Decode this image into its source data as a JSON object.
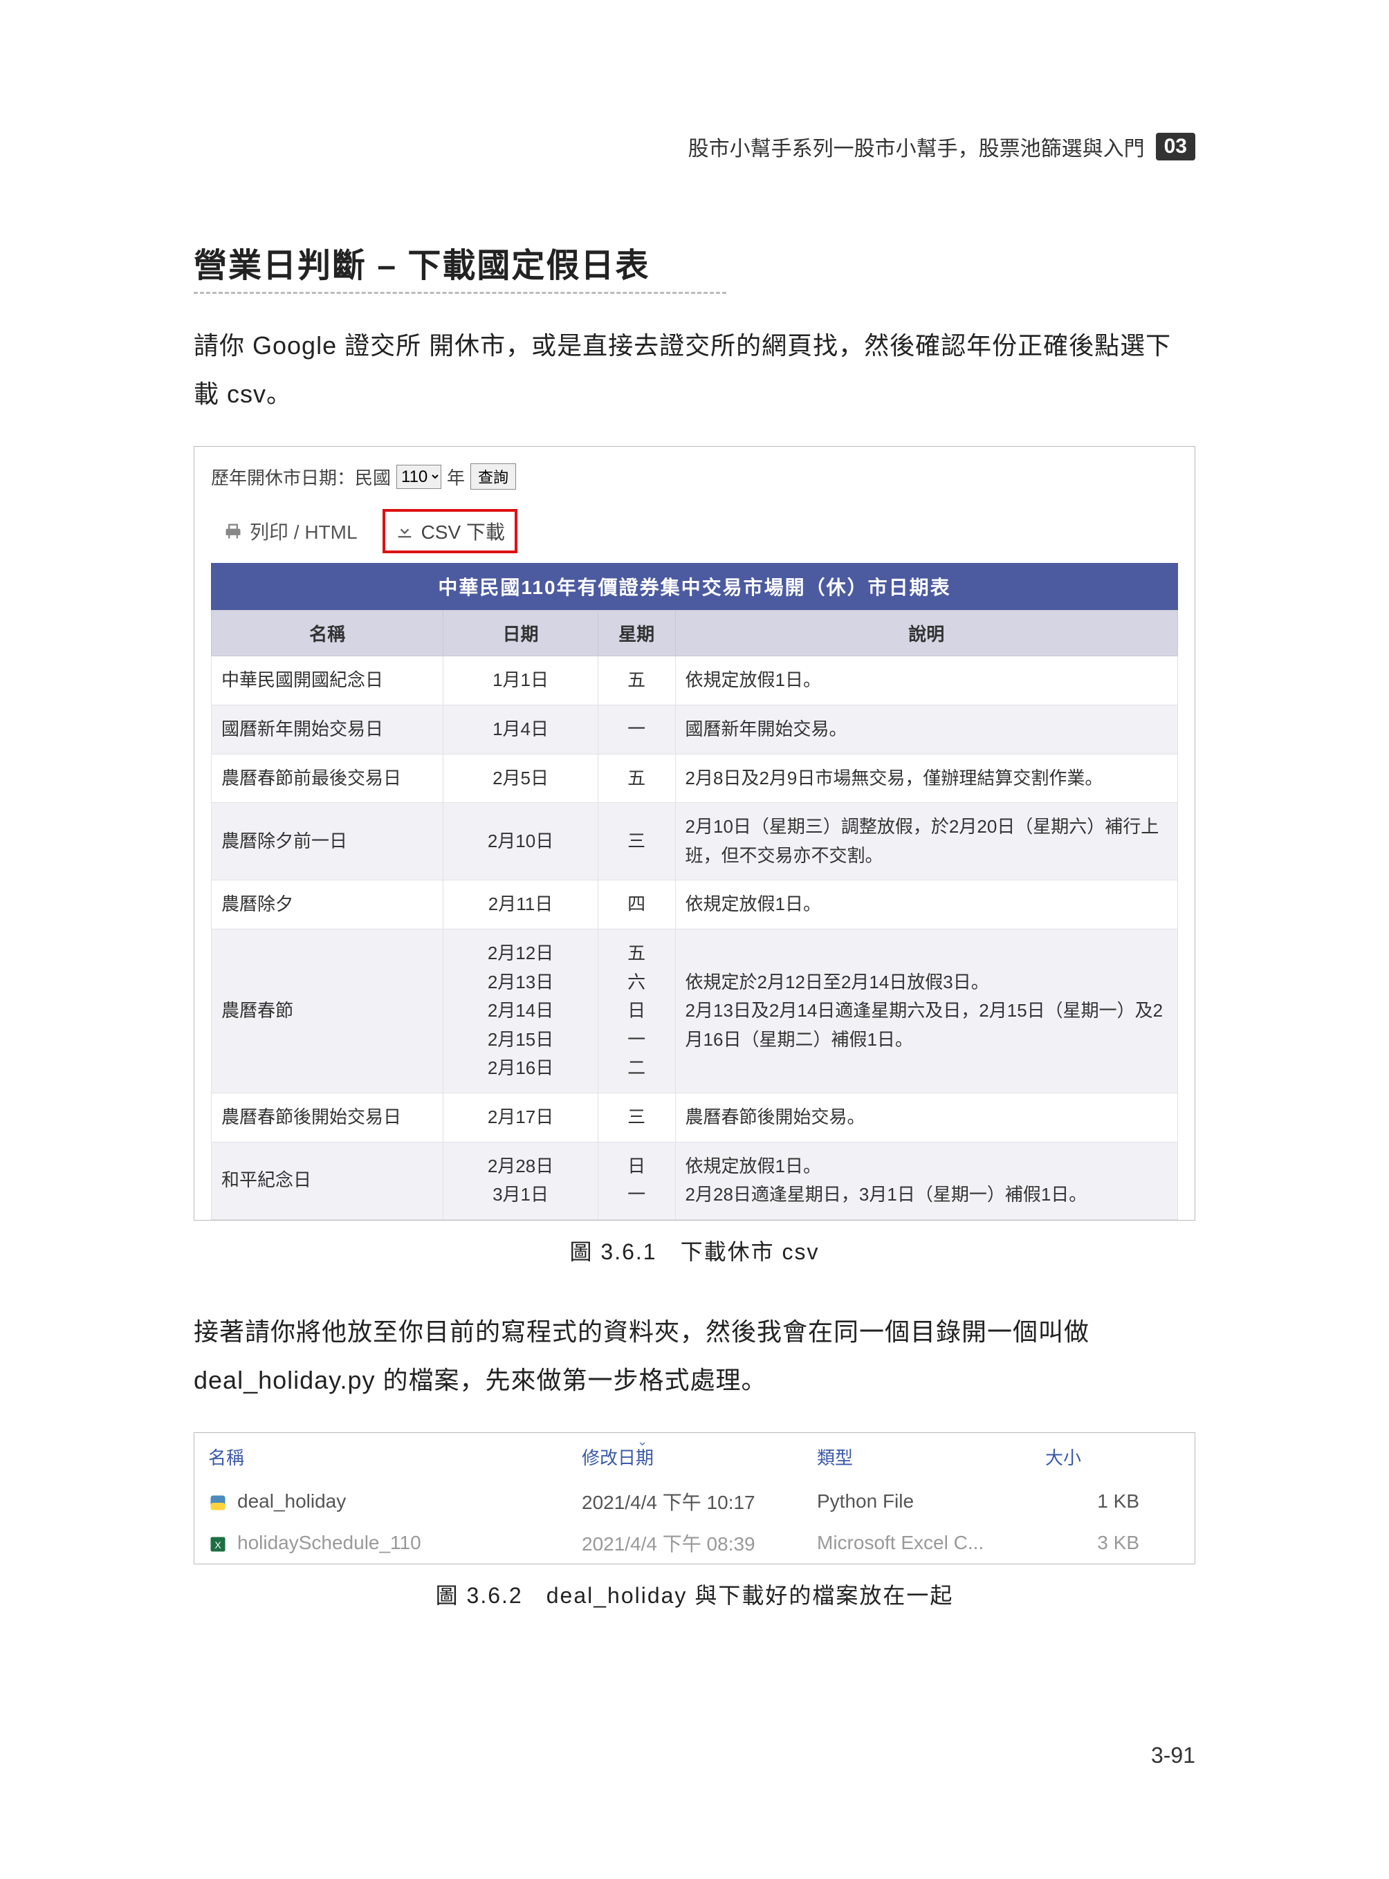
{
  "header": {
    "breadcrumb": "股市小幫手系列一股市小幫手，股票池篩選與入門",
    "chapter_badge": "03"
  },
  "section_title": "營業日判斷 – 下載國定假日表",
  "intro_paragraph": "請你 Google 證交所 開休市，或是直接去證交所的網頁找，然後確認年份正確後點選下載 csv。",
  "screenshot1": {
    "query_prefix": "歷年開休市日期：民國",
    "year_value": "110",
    "year_suffix": "年",
    "search_btn": "查詢",
    "toolbar": {
      "print_label": "列印 / HTML",
      "csv_label": "CSV 下載"
    },
    "table_caption": "中華民國110年有價證券集中交易市場開（休）市日期表",
    "columns": {
      "name": "名稱",
      "date": "日期",
      "weekday": "星期",
      "desc": "說明"
    },
    "rows": [
      {
        "name": "中華民國開國紀念日",
        "date": "1月1日",
        "wd": "五",
        "desc": "依規定放假1日。"
      },
      {
        "name": "國曆新年開始交易日",
        "date": "1月4日",
        "wd": "一",
        "desc": "國曆新年開始交易。"
      },
      {
        "name": "農曆春節前最後交易日",
        "date": "2月5日",
        "wd": "五",
        "desc": "2月8日及2月9日市場無交易，僅辦理結算交割作業。"
      },
      {
        "name": "農曆除夕前一日",
        "date": "2月10日",
        "wd": "三",
        "desc": "2月10日（星期三）調整放假，於2月20日（星期六）補行上班，但不交易亦不交割。"
      },
      {
        "name": "農曆除夕",
        "date": "2月11日",
        "wd": "四",
        "desc": "依規定放假1日。"
      },
      {
        "name": "農曆春節",
        "date": "2月12日\n2月13日\n2月14日\n2月15日\n2月16日",
        "wd": "五\n六\n日\n一\n二",
        "desc": "依規定於2月12日至2月14日放假3日。\n2月13日及2月14日適逢星期六及日，2月15日（星期一）及2月16日（星期二）補假1日。"
      },
      {
        "name": "農曆春節後開始交易日",
        "date": "2月17日",
        "wd": "三",
        "desc": "農曆春節後開始交易。"
      },
      {
        "name": "和平紀念日",
        "date": "2月28日\n3月1日",
        "wd": "日\n一",
        "desc": "依規定放假1日。\n2月28日適逢星期日，3月1日（星期一）補假1日。"
      }
    ]
  },
  "caption1": "圖 3.6.1　下載休市 csv",
  "mid_paragraph": "接著請你將他放至你目前的寫程式的資料夾，然後我會在同一個目錄開一個叫做 deal_holiday.py 的檔案，先來做第一步格式處理。",
  "files": {
    "columns": {
      "name": "名稱",
      "date": "修改日期",
      "type": "類型",
      "size": "大小"
    },
    "rows": [
      {
        "name": "deal_holiday",
        "date": "2021/4/4 下午 10:17",
        "type": "Python File",
        "size": "1 KB",
        "icon": "py"
      },
      {
        "name": "holidaySchedule_110",
        "date": "2021/4/4 下午 08:39",
        "type": "Microsoft Excel C...",
        "size": "3 KB",
        "icon": "xls"
      }
    ]
  },
  "caption2": "圖 3.6.2　deal_holiday 與下載好的檔案放在一起",
  "page_number": "3-91"
}
